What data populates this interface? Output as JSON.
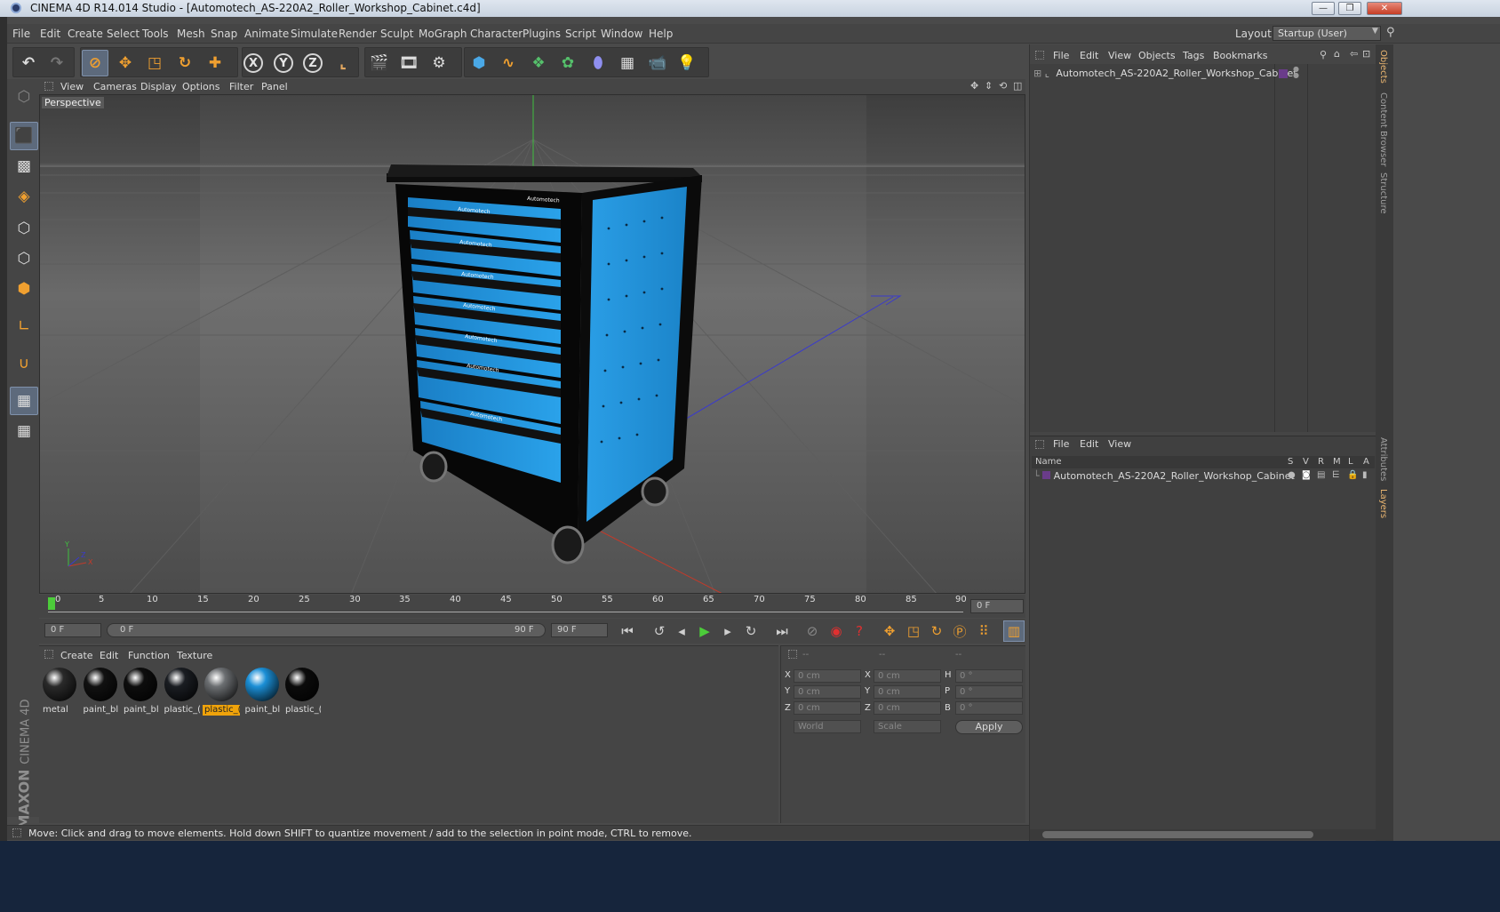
{
  "window": {
    "title": "CINEMA 4D R14.014 Studio - [Automotech_AS-220A2_Roller_Workshop_Cabinet.c4d]",
    "minimize": "—",
    "maximize": "❐",
    "close": "✕"
  },
  "menubar": {
    "items": [
      "File",
      "Edit",
      "Create",
      "Select",
      "Tools",
      "Mesh",
      "Snap",
      "Animate",
      "Simulate",
      "Render",
      "Sculpt",
      "MoGraph",
      "Character",
      "Plugins",
      "Script",
      "Window",
      "Help"
    ],
    "layout_label": "Layout:",
    "layout_value": "Startup (User)"
  },
  "toolbar": {
    "undo": "↶",
    "redo": "↷",
    "x_axis": "X",
    "y_axis": "Y",
    "z_axis": "Z"
  },
  "viewport": {
    "menu": [
      "View",
      "Cameras",
      "Display",
      "Options",
      "Filter",
      "Panel"
    ],
    "label": "Perspective",
    "axis_x": "X",
    "axis_y": "Y",
    "axis_z": "Z",
    "drawer_labels": [
      "Automotech",
      "Automotech",
      "Automotech",
      "Automotech",
      "Automotech",
      "Automotech",
      "Automotech"
    ],
    "top_label": "Automotech"
  },
  "timeline": {
    "ticks": [
      "0",
      "5",
      "10",
      "15",
      "20",
      "25",
      "30",
      "35",
      "40",
      "45",
      "50",
      "55",
      "60",
      "65",
      "70",
      "75",
      "80",
      "85",
      "90"
    ],
    "current_frame": "0 F"
  },
  "controls": {
    "start_field": "0 F",
    "range_start": "0 F",
    "range_end": "90 F",
    "end_field": "90 F"
  },
  "materials": {
    "menu": [
      "Create",
      "Edit",
      "Function",
      "Texture"
    ],
    "items": [
      {
        "label": "metal",
        "color": "#2a2a2a",
        "highlight": false
      },
      {
        "label": "paint_bl",
        "color": "#111111",
        "highlight": false
      },
      {
        "label": "paint_bl",
        "color": "#0d0d0d",
        "highlight": false
      },
      {
        "label": "plastic_(",
        "color": "#1a1d22",
        "highlight": false
      },
      {
        "label": "plastic_(",
        "color": "#6c6f72",
        "highlight": true
      },
      {
        "label": "paint_bl",
        "color": "#1b8fd6",
        "highlight": false
      },
      {
        "label": "plastic_(",
        "color": "#0b0b0b",
        "highlight": false
      }
    ]
  },
  "coordinates": {
    "headers": [
      "--",
      "--",
      "--"
    ],
    "rows": [
      {
        "a": "X",
        "av": "0 cm",
        "b": "X",
        "bv": "0 cm",
        "c": "H",
        "cv": "0 °"
      },
      {
        "a": "Y",
        "av": "0 cm",
        "b": "Y",
        "bv": "0 cm",
        "c": "P",
        "cv": "0 °"
      },
      {
        "a": "Z",
        "av": "0 cm",
        "b": "Z",
        "bv": "0 cm",
        "c": "B",
        "cv": "0 °"
      }
    ],
    "space": "World",
    "mode": "Scale",
    "apply": "Apply"
  },
  "objects_panel": {
    "menu": [
      "File",
      "Edit",
      "View",
      "Objects",
      "Tags",
      "Bookmarks"
    ],
    "object_name": "Automotech_AS-220A2_Roller_Workshop_Cabinet"
  },
  "layers_panel": {
    "menu": [
      "File",
      "Edit",
      "View"
    ],
    "columns": {
      "name": "Name",
      "s": "S",
      "v": "V",
      "r": "R",
      "m": "M",
      "l": "L",
      "a": "A"
    },
    "layer_name": "Automotech_AS-220A2_Roller_Workshop_Cabinet"
  },
  "side_tabs": [
    "Objects",
    "Content Browser",
    "Structure",
    "Attributes",
    "Layers"
  ],
  "status": "Move: Click and drag to move elements. Hold down SHIFT to quantize movement / add to the selection in point mode, CTRL to remove.",
  "branding": {
    "maxon": "MAXON",
    "cinema": "CINEMA 4D"
  },
  "colors": {
    "accent_blue": "#1b8fd6",
    "highlight_orange": "#f0a30a",
    "play_green": "#4ccc3a"
  }
}
